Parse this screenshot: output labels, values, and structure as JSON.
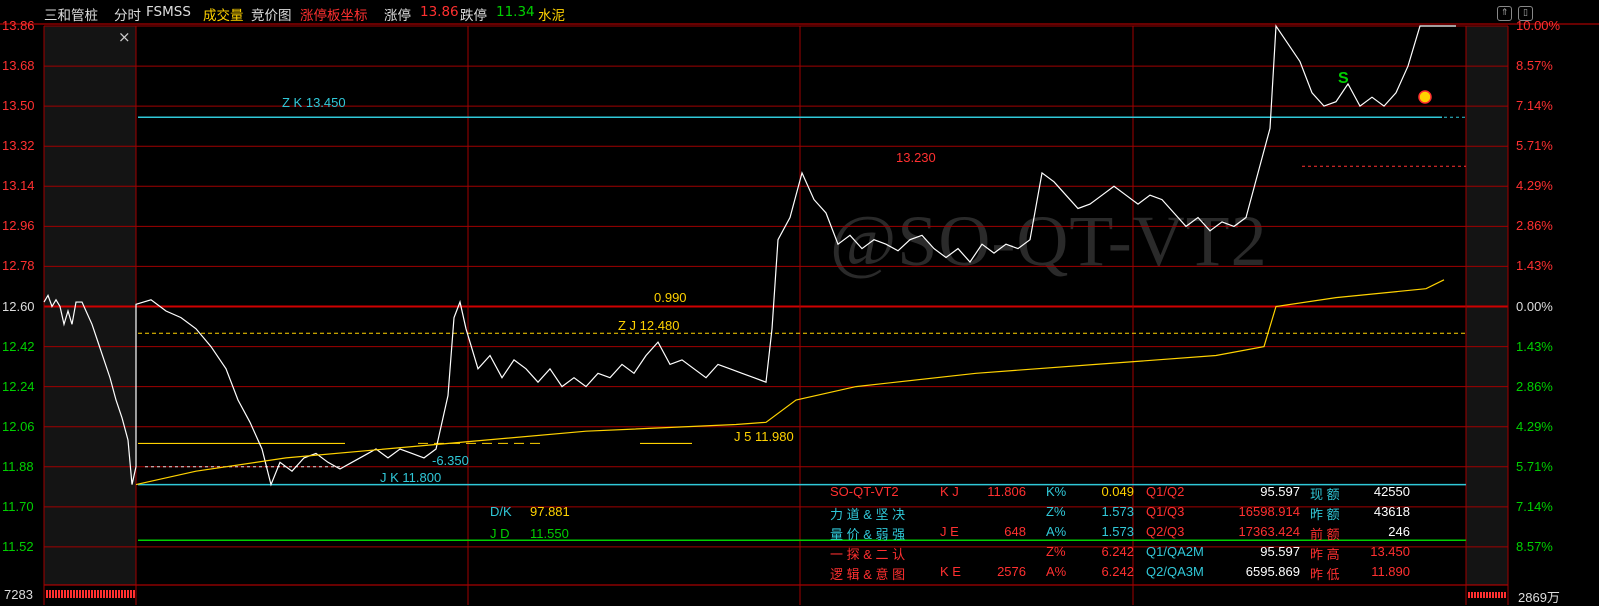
{
  "header": {
    "stock_name": "三和管桩",
    "tab_timeshare": "分时",
    "tab_fsmss": "FSMSS",
    "tab_volume": "成交量",
    "tab_auction": "竞价图",
    "tab_limit_axis": "涨停板坐标",
    "limit_up_label": "涨停",
    "limit_up_value": "13.86",
    "limit_down_label": "跌停",
    "limit_down_value": "11.34",
    "sector": "水泥"
  },
  "colors": {
    "red": "#ff3030",
    "green": "#00d000",
    "cyan": "#30c8d8",
    "yellow": "#ffd200",
    "white": "#ffffff",
    "grid": "#a00000"
  },
  "axes": {
    "left": [
      "13.86",
      "13.68",
      "13.50",
      "13.32",
      "13.14",
      "12.96",
      "12.78",
      "12.60",
      "12.42",
      "12.24",
      "12.06",
      "11.88",
      "11.70",
      "11.52"
    ],
    "right": [
      "10.00%",
      "8.57%",
      "7.14%",
      "5.71%",
      "4.29%",
      "2.86%",
      "1.43%",
      "0.00%",
      "1.43%",
      "2.86%",
      "4.29%",
      "5.71%",
      "7.14%",
      "8.57%"
    ],
    "bottom_left": "7283",
    "bottom_right": "2869万"
  },
  "watermark": "@SO-QT-VT2",
  "annotations": {
    "zk": "Z K 13.450",
    "price_13230": "13.230",
    "zj_top": "0.990",
    "zj": "Z J  12.480",
    "j5": "J 5   11.980",
    "neg": "-6.350",
    "jk": "J K      11.800",
    "dk_label": "D/K",
    "dk_value": "97.881",
    "jd_label": "J D",
    "jd_value": "11.550",
    "s_marker": "S"
  },
  "panel": {
    "rows": [
      [
        "SO-QT-VT2",
        "K J",
        "11.806",
        "K%",
        "0.049",
        "Q1/Q2",
        "95.597",
        "现 额",
        "42550"
      ],
      [
        "力 道 & 坚 决",
        "",
        "",
        "Z%",
        "1.573",
        "Q1/Q3",
        "16598.914",
        "昨 额",
        "43618"
      ],
      [
        "量 价 & 弱 强",
        "J E",
        "648",
        "A%",
        "1.573",
        "Q2/Q3",
        "17363.424",
        "前 额",
        "246"
      ],
      [
        "一 探 & 二 认",
        "",
        "",
        "Z%",
        "6.242",
        "Q1/QA2M",
        "95.597",
        "昨 高",
        "13.450"
      ],
      [
        "逻 辑 & 意 图",
        "K E",
        "2576",
        "A%",
        "6.242",
        "Q2/QA3M",
        "6595.869",
        "昨 低",
        "11.890"
      ]
    ]
  },
  "chart_data": {
    "type": "line",
    "title": "",
    "ylim": [
      11.34,
      13.86
    ],
    "price_series": [
      [
        0,
        12.61
      ],
      [
        5,
        12.63
      ],
      [
        10,
        12.58
      ],
      [
        15,
        12.55
      ],
      [
        20,
        12.5
      ],
      [
        25,
        12.42
      ],
      [
        30,
        12.32
      ],
      [
        34,
        12.18
      ],
      [
        38,
        12.08
      ],
      [
        42,
        11.96
      ],
      [
        45,
        11.8
      ],
      [
        48,
        11.9
      ],
      [
        52,
        11.86
      ],
      [
        56,
        11.92
      ],
      [
        60,
        11.94
      ],
      [
        64,
        11.9
      ],
      [
        68,
        11.87
      ],
      [
        72,
        11.9
      ],
      [
        76,
        11.93
      ],
      [
        80,
        11.96
      ],
      [
        84,
        11.92
      ],
      [
        88,
        11.96
      ],
      [
        92,
        11.94
      ],
      [
        96,
        11.92
      ],
      [
        100,
        11.96
      ],
      [
        104,
        12.2
      ],
      [
        106,
        12.55
      ],
      [
        108,
        12.62
      ],
      [
        110,
        12.5
      ],
      [
        114,
        12.32
      ],
      [
        118,
        12.38
      ],
      [
        122,
        12.28
      ],
      [
        126,
        12.36
      ],
      [
        130,
        12.32
      ],
      [
        134,
        12.26
      ],
      [
        138,
        12.32
      ],
      [
        142,
        12.24
      ],
      [
        146,
        12.28
      ],
      [
        150,
        12.24
      ],
      [
        154,
        12.3
      ],
      [
        158,
        12.28
      ],
      [
        162,
        12.34
      ],
      [
        166,
        12.3
      ],
      [
        170,
        12.38
      ],
      [
        174,
        12.44
      ],
      [
        178,
        12.34
      ],
      [
        182,
        12.36
      ],
      [
        186,
        12.32
      ],
      [
        190,
        12.28
      ],
      [
        194,
        12.34
      ],
      [
        198,
        12.32
      ],
      [
        202,
        12.3
      ],
      [
        206,
        12.28
      ],
      [
        210,
        12.26
      ],
      [
        212,
        12.5
      ],
      [
        214,
        12.9
      ],
      [
        218,
        13.0
      ],
      [
        222,
        13.2
      ],
      [
        226,
        13.08
      ],
      [
        230,
        13.02
      ],
      [
        234,
        12.88
      ],
      [
        238,
        12.92
      ],
      [
        242,
        12.86
      ],
      [
        246,
        12.9
      ],
      [
        250,
        12.88
      ],
      [
        254,
        12.85
      ],
      [
        258,
        12.9
      ],
      [
        262,
        12.92
      ],
      [
        266,
        12.86
      ],
      [
        270,
        12.82
      ],
      [
        274,
        12.86
      ],
      [
        278,
        12.8
      ],
      [
        282,
        12.88
      ],
      [
        286,
        12.84
      ],
      [
        290,
        12.88
      ],
      [
        294,
        12.86
      ],
      [
        298,
        12.9
      ],
      [
        302,
        13.2
      ],
      [
        306,
        13.16
      ],
      [
        310,
        13.1
      ],
      [
        314,
        13.04
      ],
      [
        318,
        13.06
      ],
      [
        322,
        13.1
      ],
      [
        326,
        13.14
      ],
      [
        330,
        13.1
      ],
      [
        334,
        13.06
      ],
      [
        338,
        13.1
      ],
      [
        342,
        13.08
      ],
      [
        346,
        13.02
      ],
      [
        350,
        12.96
      ],
      [
        354,
        13.0
      ],
      [
        358,
        12.94
      ],
      [
        362,
        12.98
      ],
      [
        366,
        12.96
      ],
      [
        370,
        13.0
      ],
      [
        374,
        13.2
      ],
      [
        378,
        13.4
      ],
      [
        380,
        13.86
      ],
      [
        384,
        13.78
      ],
      [
        388,
        13.7
      ],
      [
        392,
        13.56
      ],
      [
        396,
        13.5
      ],
      [
        400,
        13.52
      ],
      [
        404,
        13.6
      ],
      [
        408,
        13.5
      ],
      [
        412,
        13.54
      ],
      [
        416,
        13.5
      ],
      [
        420,
        13.56
      ],
      [
        424,
        13.68
      ],
      [
        428,
        13.86
      ],
      [
        432,
        13.86
      ],
      [
        440,
        13.86
      ]
    ],
    "avg_series": [
      [
        0,
        11.8
      ],
      [
        20,
        11.86
      ],
      [
        50,
        11.92
      ],
      [
        100,
        11.98
      ],
      [
        150,
        12.04
      ],
      [
        200,
        12.07
      ],
      [
        210,
        12.08
      ],
      [
        220,
        12.18
      ],
      [
        240,
        12.24
      ],
      [
        280,
        12.3
      ],
      [
        320,
        12.34
      ],
      [
        360,
        12.38
      ],
      [
        376,
        12.42
      ],
      [
        380,
        12.6
      ],
      [
        400,
        12.64
      ],
      [
        430,
        12.68
      ],
      [
        436,
        12.72
      ]
    ],
    "levels": {
      "zk": 13.45,
      "zj": 12.48,
      "jk": 11.8,
      "jd": 11.55
    }
  }
}
